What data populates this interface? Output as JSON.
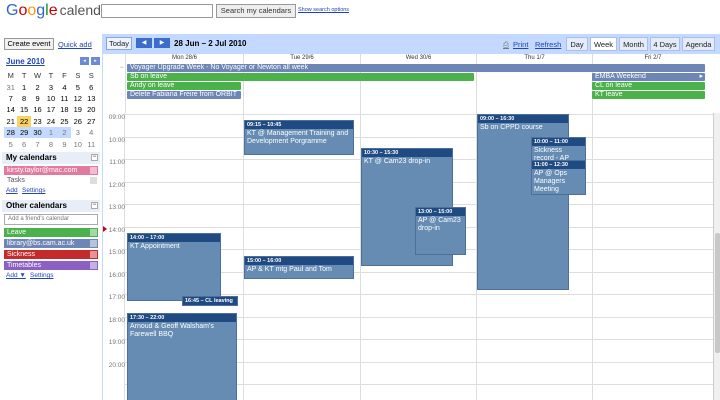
{
  "header": {
    "logo_google": "Google",
    "logo_calendar": "calendar",
    "search_button": "Search my calendars",
    "search_options": "Show search options",
    "search_value": ""
  },
  "sidebar": {
    "create_event": "Create event",
    "quick_add": "Quick add",
    "mini_cal": {
      "title": "June 2010",
      "prev": "◂",
      "next": "▸",
      "dow": [
        "M",
        "T",
        "W",
        "T",
        "F",
        "S",
        "S"
      ],
      "weeks": [
        [
          "31",
          "1",
          "2",
          "3",
          "4",
          "5",
          "6"
        ],
        [
          "7",
          "8",
          "9",
          "10",
          "11",
          "12",
          "13"
        ],
        [
          "14",
          "15",
          "16",
          "17",
          "18",
          "19",
          "20"
        ],
        [
          "21",
          "22",
          "23",
          "24",
          "25",
          "26",
          "27"
        ],
        [
          "28",
          "29",
          "30",
          "1",
          "2",
          "3",
          "4"
        ],
        [
          "5",
          "6",
          "7",
          "8",
          "9",
          "10",
          "11"
        ]
      ]
    },
    "my_calendars": {
      "title": "My calendars",
      "items": [
        {
          "label": "kirsty.taylor@mac.com",
          "color": "#e07aa0"
        },
        {
          "label": "Tasks",
          "color": ""
        }
      ],
      "add": "Add",
      "settings": "Settings"
    },
    "other_calendars": {
      "title": "Other calendars",
      "placeholder": "Add a friend's calendar",
      "items": [
        {
          "label": "Leave",
          "color": "#4bb14b"
        },
        {
          "label": "library@bs.cam.ac.uk",
          "color": "#6e86b6"
        },
        {
          "label": "Sickness",
          "color": "#c62b2b"
        },
        {
          "label": "Timetables",
          "color": "#8c5fc2"
        }
      ],
      "add": "Add ▼",
      "settings": "Settings"
    }
  },
  "toolbar": {
    "today": "Today",
    "prev": "◀",
    "next": "▶",
    "date_range": "28 Jun – 2 Jul 2010",
    "print": "Print",
    "refresh": "Refresh",
    "views": [
      "Day",
      "Week",
      "Month",
      "4 Days",
      "Agenda"
    ],
    "active_view": "Week"
  },
  "days": [
    "Mon 28/6",
    "Tue 29/6",
    "Wed 30/6",
    "Thu 1/7",
    "Fri 2/7"
  ],
  "hours": [
    "09:00",
    "10:00",
    "11:00",
    "12:00",
    "13:00",
    "14:00",
    "15:00",
    "16:00",
    "17:00",
    "18:00",
    "19:00",
    "20:00"
  ],
  "allday_events": [
    {
      "title": "Voyager Upgrade Week - No Voyager or Newton all week",
      "color": "#6e86b6"
    },
    {
      "title": "Sb on leave",
      "color": "#4bb14b"
    },
    {
      "title": "Andy on leave",
      "color": "#4bb14b"
    },
    {
      "title": "Delete Fabiana Freire from ORBIT",
      "color": "#6e86b6"
    },
    {
      "title": "EMBA Weekend",
      "color": "#6e86b6",
      "arrow": "▸"
    },
    {
      "title": "CL on leave",
      "color": "#4bb14b"
    },
    {
      "title": "KT leave",
      "color": "#4bb14b"
    }
  ],
  "events": [
    {
      "time": "09:15 – 10:45",
      "title": "KT @ Management Training and Development Porgramme"
    },
    {
      "time": "10:30 – 15:30",
      "title": "KT @ Cam23 drop-in"
    },
    {
      "time": "13:00 – 15:00",
      "title": "AP @ Cam23 drop-in"
    },
    {
      "time": "09:00 – 16:30",
      "title": "Sb on CPPD course"
    },
    {
      "time": "10:00 – 11:00",
      "title": "Sickness record - AP"
    },
    {
      "time": "11:00 – 12:30",
      "title": "AP @ Ops Managers Meeting"
    },
    {
      "time": "14:00 – 17:00",
      "title": "KT Appointment"
    },
    {
      "time": "15:00 – 16:00",
      "title": "AP & KT mtg Paul and Tom"
    },
    {
      "time": "16:45 – CL leaving",
      "title": ""
    },
    {
      "time": "17:30 – 22:00",
      "title": "Arnoud & Geoff Walsham's Farewell BBQ"
    }
  ]
}
